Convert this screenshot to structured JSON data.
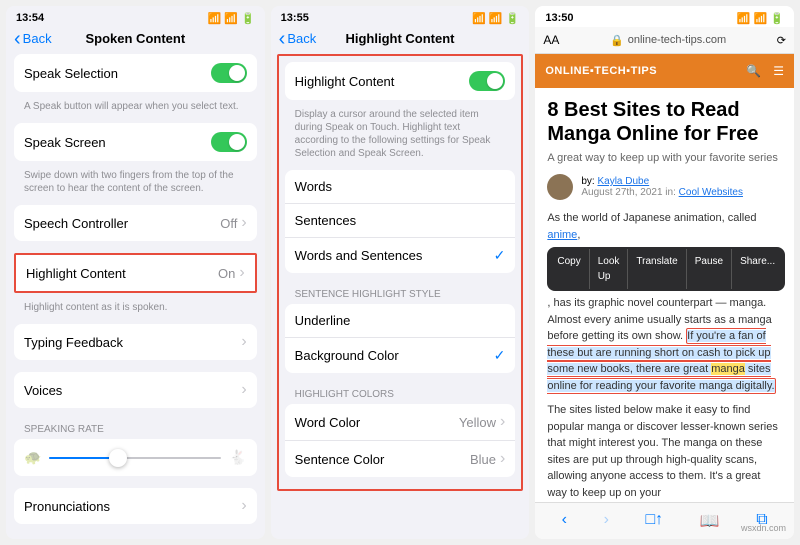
{
  "phone1": {
    "time": "13:54",
    "back": "Back",
    "title": "Spoken Content",
    "speakSelection": "Speak Selection",
    "speakSelectionHint": "A Speak button will appear when you select text.",
    "speakScreen": "Speak Screen",
    "speakScreenHint": "Swipe down with two fingers from the top of the screen to hear the content of the screen.",
    "speechController": "Speech Controller",
    "speechControllerVal": "Off",
    "highlightContent": "Highlight Content",
    "highlightContentVal": "On",
    "highlightHint": "Highlight content as it is spoken.",
    "typingFeedback": "Typing Feedback",
    "voices": "Voices",
    "speakingRate": "SPEAKING RATE",
    "pronunciations": "Pronunciations"
  },
  "phone2": {
    "time": "13:55",
    "back": "Back",
    "title": "Highlight Content",
    "highlightContent": "Highlight Content",
    "hint": "Display a cursor around the selected item during Speak on Touch. Highlight text according to the following settings for Speak Selection and Speak Screen.",
    "words": "Words",
    "sentences": "Sentences",
    "wordsAndSentences": "Words and Sentences",
    "styleHead": "SENTENCE HIGHLIGHT STYLE",
    "underline": "Underline",
    "backgroundColor": "Background Color",
    "colorsHead": "HIGHLIGHT COLORS",
    "wordColor": "Word Color",
    "wordColorVal": "Yellow",
    "sentenceColor": "Sentence Color",
    "sentenceColorVal": "Blue"
  },
  "phone3": {
    "time": "13:50",
    "aa": "AA",
    "url": "online-tech-tips.com",
    "logo": "ONLINE▪TECH▪TIPS",
    "h1": "8 Best Sites to Read Manga Online for Free",
    "sub": "A great way to keep up with your favorite series",
    "by": "by:",
    "author": "Kayla Dube",
    "date": "August 27th, 2021 in:",
    "cat": "Cool Websites",
    "p1a": "As the world of Japanese animation, called ",
    "p1link": "anime",
    "p1b": ", has its graphic novel counterpart — manga. Almost every anime usually starts as a manga before getting its own show. ",
    "p1hl": "If you're a fan of these but are running short on cash to pick up some new books, there are great ",
    "p1word": "manga",
    "p1hl2": " sites online for reading your favorite manga digitally.",
    "p2": "The sites listed below make it easy to find popular manga or discover lesser-known series that might interest you. The manga on these sites are put up through high-quality scans, allowing anyone access to them. It's a great way to keep up on your",
    "menu": {
      "copy": "Copy",
      "lookup": "Look Up",
      "translate": "Translate",
      "pause": "Pause",
      "share": "Share..."
    }
  },
  "watermark": "wsxdn.com"
}
